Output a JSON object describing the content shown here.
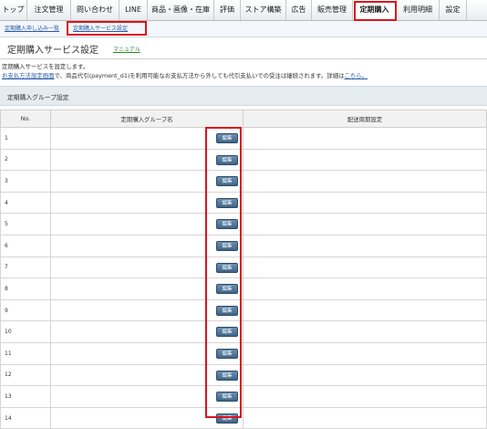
{
  "nav": {
    "tabs": [
      "トップ",
      "注文管理",
      "問い合わせ",
      "LINE",
      "商品・画像・在庫",
      "評価",
      "ストア構築",
      "広告",
      "販売管理",
      "定期購入",
      "利用明細",
      "設定"
    ],
    "active": "定期購入"
  },
  "subnav": {
    "links": [
      "定期購入申し込み一覧",
      "定期購入サービス設定"
    ],
    "active": "定期購入サービス設定"
  },
  "page": {
    "title": "定期購入サービス設定",
    "manual_link": "マニュアル",
    "desc_line1": "定期購入サービスを設定します。",
    "desc_link": "お支払方法設定画面",
    "desc_line2_text": "で、商品代引(payment_d1)を利用可能なお支払方法から外しても代引支払いでの受注は継続されます。詳細は",
    "desc_link2": "こちら。"
  },
  "section": {
    "title": "定期購入グループ設定"
  },
  "table": {
    "headers": [
      "No.",
      "定期購入グループ名",
      "配送周期設定"
    ],
    "edit_label": "編集",
    "rows": [
      "1",
      "2",
      "3",
      "4",
      "5",
      "6",
      "7",
      "8",
      "9",
      "10",
      "11",
      "12",
      "13",
      "14"
    ]
  },
  "colors": {
    "highlight": "#d9141e",
    "link": "#2a5aa8",
    "button": "#3f6486"
  }
}
